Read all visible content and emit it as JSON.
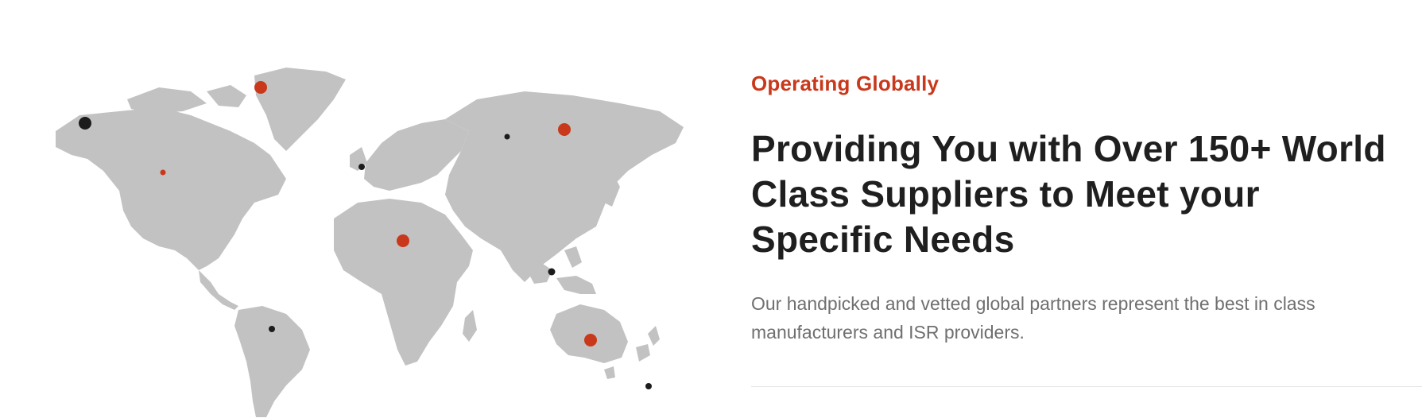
{
  "section": {
    "eyebrow": "Operating Globally",
    "headline": "Providing You with Over 150+ World Class Suppliers to Meet your Specific Needs",
    "description": "Our handpicked and vetted global partners represent the best in class manufacturers and ISR providers."
  },
  "colors": {
    "accent": "#c9381a",
    "marker_dark": "#1c1c1c",
    "land": "#c2c2c2",
    "heading": "#1f1f1f",
    "body_text": "#6f6f6f"
  },
  "map": {
    "icon": "world-map-icon",
    "markers": [
      {
        "region": "alaska",
        "color": "dark",
        "size": "large"
      },
      {
        "region": "greenland",
        "color": "accent",
        "size": "large"
      },
      {
        "region": "north-america",
        "color": "accent",
        "size": "small"
      },
      {
        "region": "united-kingdom",
        "color": "dark",
        "size": "small"
      },
      {
        "region": "russia-west",
        "color": "dark",
        "size": "small"
      },
      {
        "region": "russia-east",
        "color": "accent",
        "size": "large"
      },
      {
        "region": "central-africa",
        "color": "accent",
        "size": "large"
      },
      {
        "region": "south-america",
        "color": "dark",
        "size": "small"
      },
      {
        "region": "southeast-asia",
        "color": "dark",
        "size": "small"
      },
      {
        "region": "australia",
        "color": "accent",
        "size": "large"
      },
      {
        "region": "new-zealand",
        "color": "dark",
        "size": "small"
      }
    ]
  }
}
